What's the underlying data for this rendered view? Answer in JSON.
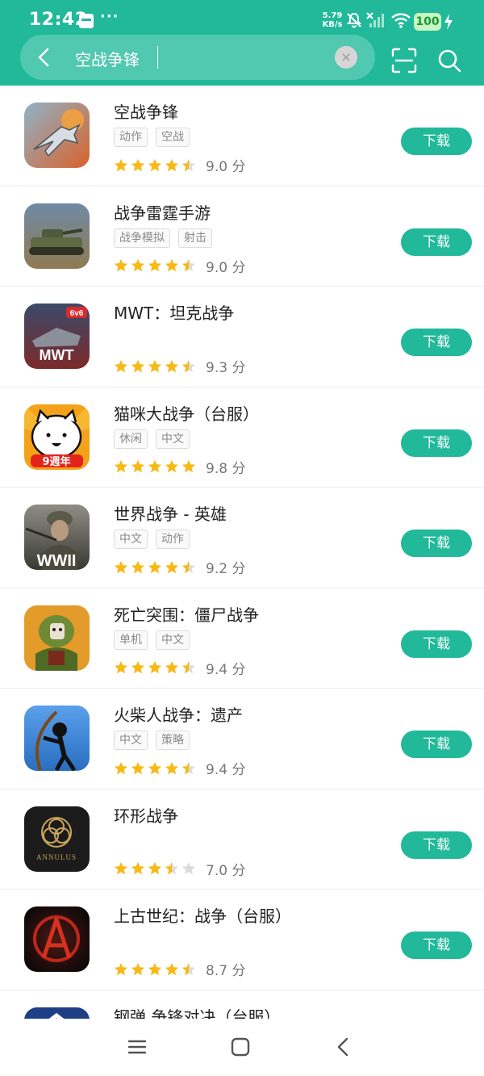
{
  "status": {
    "time": "12:42",
    "net_speed_top": "5.79",
    "net_speed_bottom": "KB/s",
    "battery": "100"
  },
  "search": {
    "query": "空战争锋",
    "clear": "×"
  },
  "download_label": "下载",
  "score_suffix": "分",
  "apps": [
    {
      "name": "空战争锋",
      "tags": [
        "动作",
        "空战"
      ],
      "score": "9.0",
      "stars": 4.5,
      "icon": "jet-fighter-icon",
      "colors": [
        "#8fb3c9",
        "#d9622a"
      ]
    },
    {
      "name": "战争雷霆手游",
      "tags": [
        "战争模拟",
        "射击"
      ],
      "score": "9.0",
      "stars": 4.5,
      "icon": "tank-icon",
      "colors": [
        "#6f8aa6",
        "#7b6a4a"
      ]
    },
    {
      "name": "MWT：坦克战争",
      "tags": [],
      "score": "9.3",
      "stars": 4.5,
      "icon": "mwt-tank-icon",
      "colors": [
        "#7c2a2a",
        "#2a3a5a"
      ]
    },
    {
      "name": "猫咪大战争（台服）",
      "tags": [
        "休闲",
        "中文"
      ],
      "score": "9.8",
      "stars": 5,
      "icon": "battle-cat-icon",
      "colors": [
        "#f4a21a",
        "#e3241c"
      ]
    },
    {
      "name": "世界战争 - 英雄",
      "tags": [
        "中文",
        "动作"
      ],
      "score": "9.2",
      "stars": 4.5,
      "icon": "soldier-icon",
      "colors": [
        "#5a5a52",
        "#9a9a90"
      ]
    },
    {
      "name": "死亡突围：僵尸战争",
      "tags": [
        "单机",
        "中文"
      ],
      "score": "9.4",
      "stars": 4.5,
      "icon": "zombie-icon",
      "colors": [
        "#e39b2a",
        "#5f7a2a"
      ]
    },
    {
      "name": "火柴人战争：遗产",
      "tags": [
        "中文",
        "策略"
      ],
      "score": "9.4",
      "stars": 4.5,
      "icon": "stickman-icon",
      "colors": [
        "#3a7ed8",
        "#1a1a1a"
      ]
    },
    {
      "name": "环形战争",
      "tags": [],
      "score": "7.0",
      "stars": 3.5,
      "icon": "annulus-icon",
      "colors": [
        "#1b1b1b",
        "#c9a45a"
      ]
    },
    {
      "name": "上古世纪：战争（台服）",
      "tags": [],
      "score": "8.7",
      "stars": 4.5,
      "icon": "archeage-icon",
      "colors": [
        "#1a0c0c",
        "#c0261a"
      ]
    },
    {
      "name": "钢弹 争锋对决（台服）",
      "tags": [],
      "score": "",
      "stars": 0,
      "icon": "gundam-icon",
      "colors": [
        "#1e3f86",
        "#ffffff"
      ]
    }
  ],
  "icon_texts": {
    "mwt": "MWT",
    "mwt_badge": "6v6",
    "cat_banner": "9週年",
    "wwii": "WWII",
    "annulus": "ANNULUS"
  },
  "theme": {
    "accent": "#21b99a",
    "star": "#f8b912",
    "star_empty": "#dcdcdc"
  }
}
